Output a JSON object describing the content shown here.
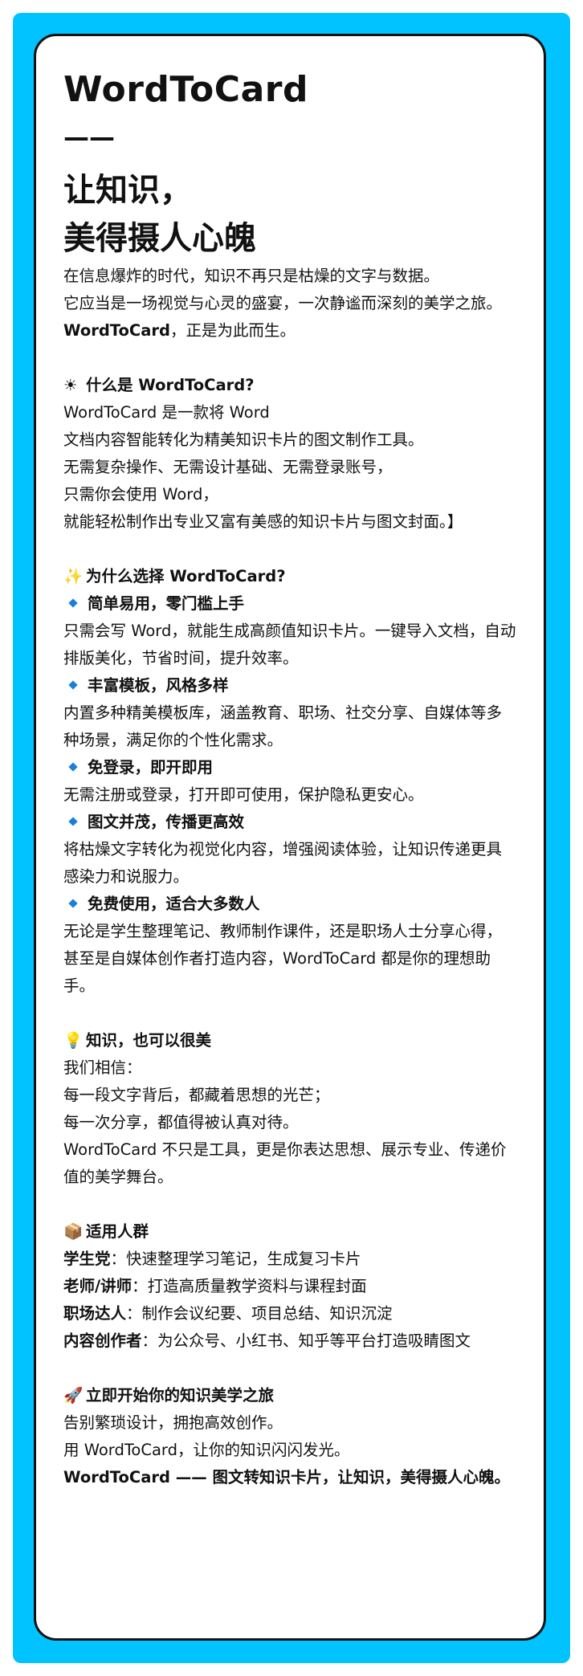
{
  "brand": "WordToCard",
  "dash": "——",
  "headline": [
    "让知识，",
    "美得摄人心魄"
  ],
  "intro": {
    "lines": [
      "在信息爆炸的时代，知识不再只是枯燥的文字与数据。",
      "它应当是一场视觉与心灵的盛宴，一次静谧而深刻的美学之旅。"
    ],
    "tag_bold": "WordToCard",
    "tag_rest": "，正是为此而生。"
  },
  "what": {
    "icon": "☀",
    "title": "什么是 WordToCard?",
    "lines": [
      "WordToCard 是一款将 Word",
      "文档内容智能转化为精美知识卡片的图文制作工具。",
      "无需复杂操作、无需设计基础、无需登录账号，",
      "只需你会使用 Word，",
      "就能轻松制作出专业又富有美感的知识卡片与图文封面。】"
    ]
  },
  "why": {
    "icon": "✨",
    "title": "为什么选择 WordToCard?",
    "items": [
      {
        "title": "简单易用，零门槛上手",
        "desc": "只需会写 Word，就能生成高颜值知识卡片。一键导入文档，自动排版美化，节省时间，提升效率。"
      },
      {
        "title": "丰富模板，风格多样",
        "desc": "内置多种精美模板库，涵盖教育、职场、社交分享、自媒体等多种场景，满足你的个性化需求。"
      },
      {
        "title": "免登录，即开即用",
        "desc": "无需注册或登录，打开即可使用，保护隐私更安心。"
      },
      {
        "title": "图文并茂，传播更高效",
        "desc": "将枯燥文字转化为视觉化内容，增强阅读体验，让知识传递更具感染力和说服力。"
      },
      {
        "title": "免费使用，适合大多数人",
        "desc": "无论是学生整理笔记、教师制作课件，还是职场人士分享心得，甚至是自媒体创作者打造内容，WordToCard 都是你的理想助手。"
      }
    ]
  },
  "beauty": {
    "icon": "💡",
    "title": "知识，也可以很美",
    "lines": [
      "我们相信：",
      "每一段文字背后，都藏着思想的光芒；",
      "每一次分享，都值得被认真对待。",
      "WordToCard 不只是工具，更是你表达思想、展示专业、传递价值的美学舞台。"
    ]
  },
  "audience": {
    "icon": "📦",
    "title": "适用人群",
    "items": [
      {
        "who": "学生党",
        "what": "：快速整理学习笔记，生成复习卡片"
      },
      {
        "who": "老师/讲师",
        "what": "：打造高质量教学资料与课程封面"
      },
      {
        "who": "职场达人",
        "what": "：制作会议纪要、项目总结、知识沉淀"
      },
      {
        "who": "内容创作者",
        "what": "：为公众号、小红书、知乎等平台打造吸睛图文"
      }
    ]
  },
  "start": {
    "icon": "🚀",
    "title": "立即开始你的知识美学之旅",
    "lines": [
      "告别繁琐设计，拥抱高效创作。",
      "用 WordToCard，让你的知识闪闪发光。"
    ],
    "slogan": "WordToCard —— 图文转知识卡片，让知识，美得摄人心魄。"
  }
}
